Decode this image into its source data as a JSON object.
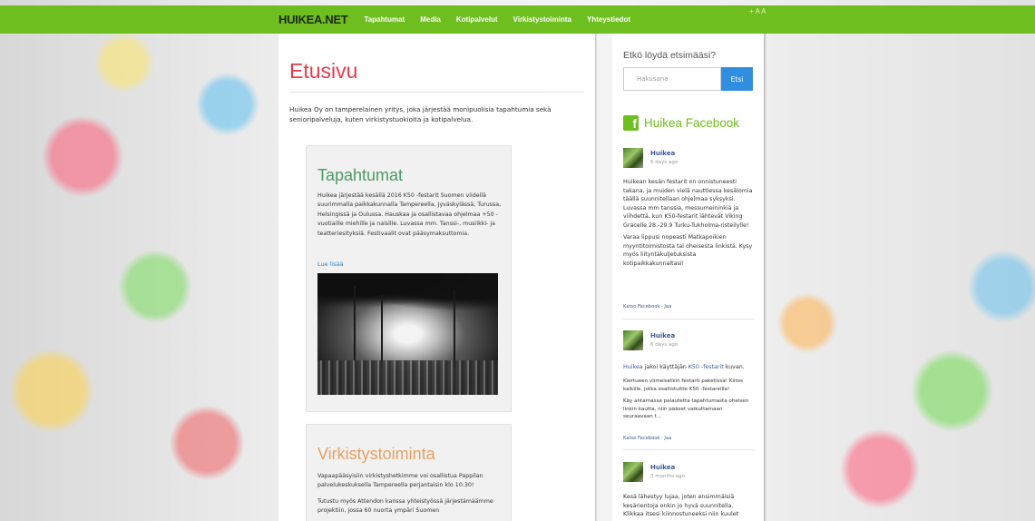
{
  "header": {
    "brand": "HUIKEA.NET",
    "nav": [
      "Tapahtumat",
      "Media",
      "Kotipalvelut",
      "Virkistystoiminta",
      "Yhteystiedot"
    ],
    "font_size_controls": "+ A A",
    "bar_color": "#6fbe1f"
  },
  "main": {
    "title": "Etusivu",
    "intro": "Huikea Oy on tamperelainen yritys, joka järjestää monipuolisia tapahtumia sekä senioripalveluja, kuten virkistystuokioita ja kotipalvelua.",
    "cards": [
      {
        "title": "Tapahtumat",
        "body": "Huikea järjestää kesällä 2016 K50 -festarit Suomen viidellä suurimmalla paikkakunnalla Tampereella, Jyväskylässä, Turussa, Helsingissä ja Oulussa. Hauskaa ja osallistavaa ohjelmaa +50 -vuotiaille miehille ja naisille. Luvassa mm. Tanssi-, musiikki- ja teatteriesityksiä. Festivaalit ovat pääsymaksuttomia.",
        "read_more": "Lue lisää"
      },
      {
        "title": "Virkistystoiminta",
        "body1": "Vapaapääsyisiin virkistyshetkimme voi osallistua Pappilan palvelukeskuksella Tampereella perjantaisin klo 10:30!",
        "body2": "Tutustu myös Attendon kanssa yhteistyössä järjestämäämme projektiin, jossa 60 nuorta ympäri Suomen"
      }
    ]
  },
  "sidebar": {
    "search_heading": "Etkö löydä etsimääsi?",
    "search_placeholder": "Hakusana",
    "search_button": "Etsi",
    "facebook_icon": "f",
    "facebook_heading": "Huikea Facebook",
    "posts": [
      {
        "author": "Huikea",
        "time": "6 days ago",
        "text1": "Huikean kesän festarit on onnistuneesti takana, ja muiden vielä nauttiessa kesälomia täällä suunnitellaan ohjelmaa syksyksi. Luvassa mm tanssia, messumeininkiä ja viihdettä, kun K50-festarit lähtevät Viking Gracelle 28.-29.9 Turku-Tukholma-risteilylle!",
        "text2": "Varaa lippusi nopeasti Matkapoikien myyntitoimistosta tai oheisesta linkistä. Kysy myös liityntäkuljetuksista kotipaikkakunnaltasi!",
        "links": "Katso Facebook · Jaa"
      },
      {
        "author": "Huikea",
        "time": "6 days ago",
        "share_pre": "Huikea",
        "share_mid": " jakoi käyttäjän ",
        "share_page": "K50 -festarit",
        "share_post": " kuvan.",
        "text1": "Kiertueen viimeisetkin festarit paketissa! Kiitos kaikille, jotka osallistuitte K50 -festareille!",
        "text2": "Käy antamassa palautetta tapahtumasta oheisen linkin kautta, niin pääset vaikuttamaan seuraavaan t...",
        "links": "Katso Facebook · Jaa"
      },
      {
        "author": "Huikea",
        "time": "3 months ago",
        "text1": "Kesä lähestyy lujaa, joten ensimmäisiä kesärientoja onkin jo hyvä suunnitella. Klikkaa itsesi kiinnostuneeksi niin kuulet"
      }
    ]
  }
}
